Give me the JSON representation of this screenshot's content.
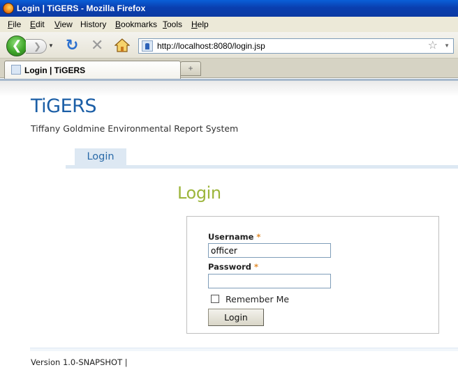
{
  "window": {
    "title": "Login | TiGERS - Mozilla Firefox"
  },
  "menubar": {
    "items": [
      {
        "accel": "F",
        "rest": "ile"
      },
      {
        "accel": "E",
        "rest": "dit"
      },
      {
        "accel": "V",
        "rest": "iew"
      },
      {
        "accel": "H",
        "rest": "istory",
        "accel_pos": "prefix"
      },
      {
        "accel": "B",
        "rest": "ookmarks"
      },
      {
        "accel": "T",
        "rest": "ools"
      },
      {
        "accel": "H",
        "rest": "elp"
      }
    ]
  },
  "toolbar": {
    "back_glyph": "❮",
    "forward_glyph": "❯",
    "dropdown_glyph": "▼",
    "reload_glyph": "↻",
    "stop_glyph": "✕",
    "url": "http://localhost:8080/login.jsp",
    "star_glyph": "☆",
    "url_dropdown_glyph": "▼"
  },
  "tabs": {
    "active_label": "Login | TiGERS",
    "new_tab_glyph": "+"
  },
  "page": {
    "brand": "TiGERS",
    "subtitle": "Tiffany Goldmine Environmental Report System",
    "nav_tab": "Login",
    "heading": "Login",
    "form": {
      "username_label": "Username",
      "password_label": "Password",
      "required_marker": "*",
      "username_value": "officer",
      "password_value": "",
      "remember_label": "Remember Me",
      "remember_checked": false,
      "submit_label": "Login"
    },
    "footer": "Version 1.0-SNAPSHOT |"
  },
  "colors": {
    "brand": "#1b5ea6",
    "heading": "#9cb53b",
    "required": "#e08a2a",
    "nav_tab_bg": "#dde8f3"
  }
}
